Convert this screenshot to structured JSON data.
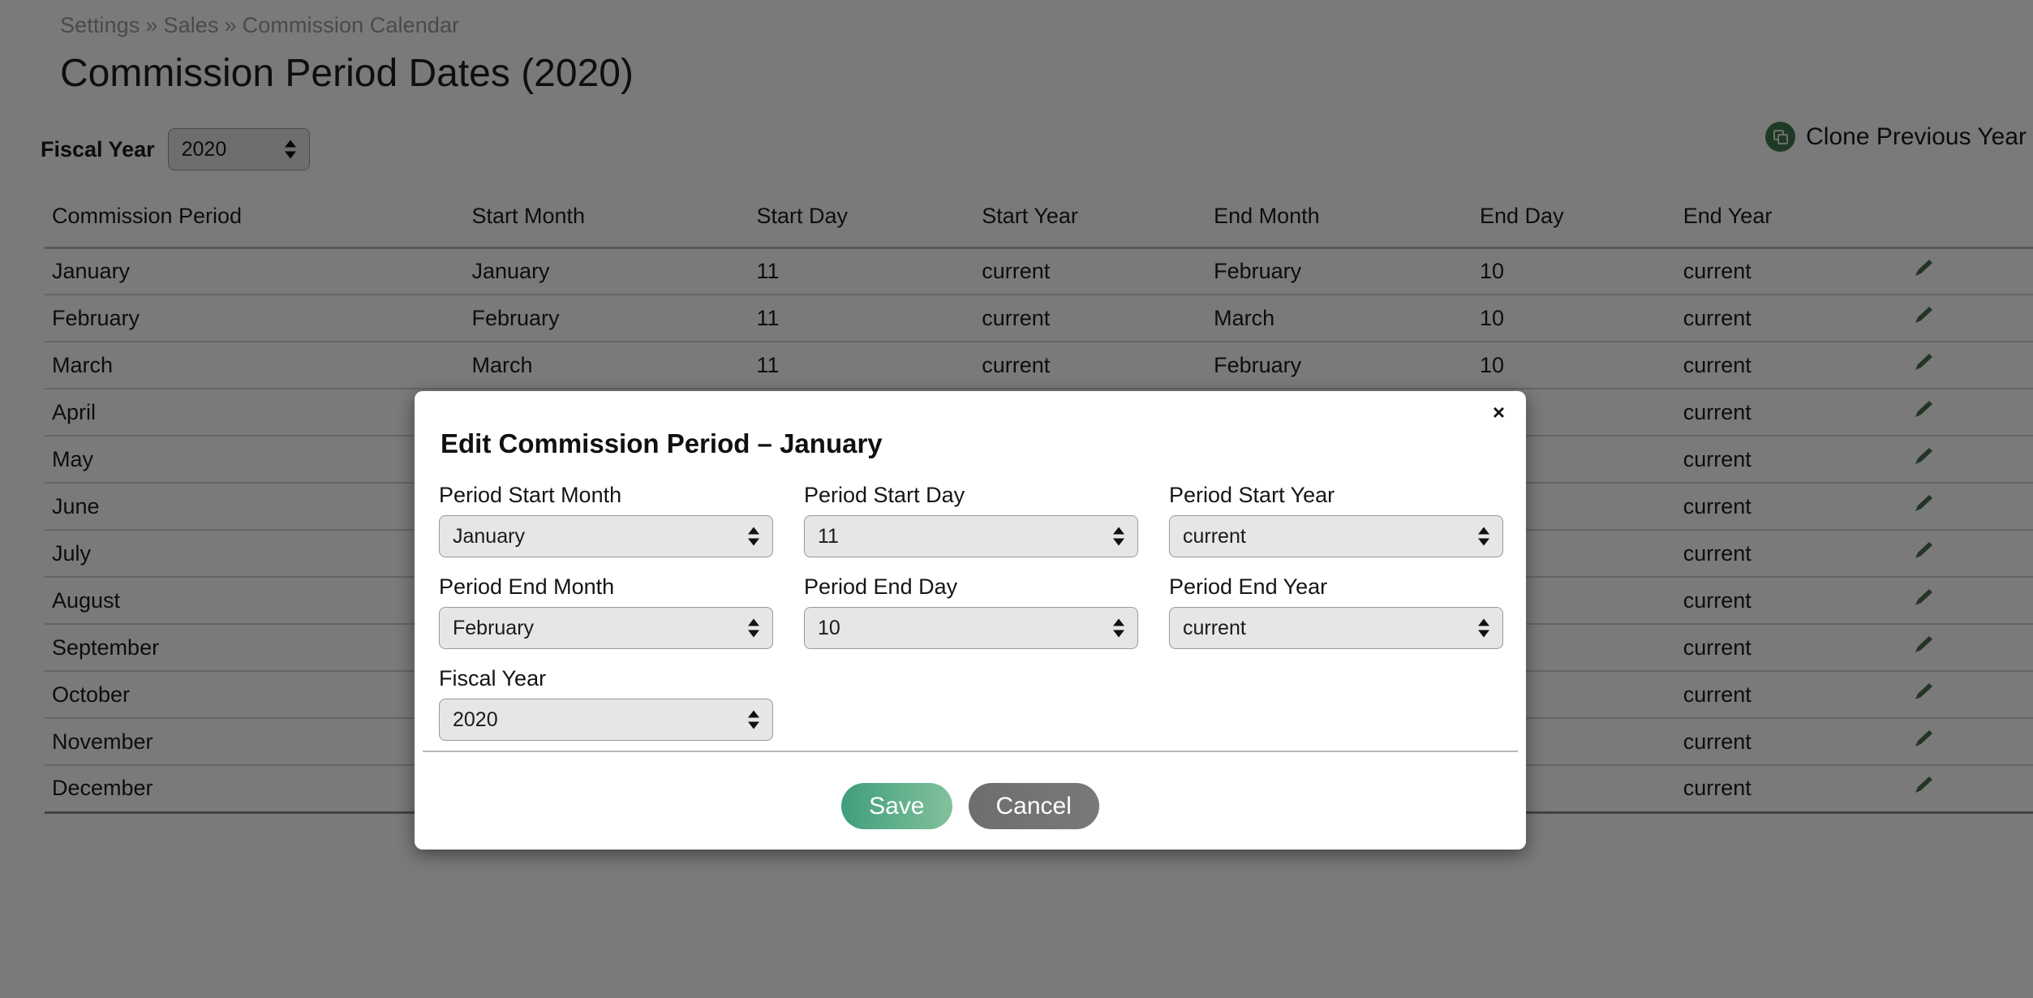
{
  "breadcrumb": {
    "items": [
      "Settings",
      "Sales",
      "Commission Calendar"
    ],
    "separator": "»"
  },
  "page_title": "Commission Period Dates (2020)",
  "fiscal_year_filter": {
    "label": "Fiscal Year",
    "value": "2020"
  },
  "clone_button": {
    "label": "Clone Previous Year",
    "icon": "copy-icon",
    "accent": "#3f7a4f"
  },
  "table": {
    "headers": [
      "Commission Period",
      "Start Month",
      "Start Day",
      "Start Year",
      "End Month",
      "End Day",
      "End Year",
      ""
    ],
    "edit_icon": "pencil-icon",
    "edit_icon_color": "#4a6f4f",
    "rows": [
      {
        "period": "January",
        "start_month": "January",
        "start_day": "11",
        "start_year": "current",
        "end_month": "February",
        "end_day": "10",
        "end_year": "current"
      },
      {
        "period": "February",
        "start_month": "February",
        "start_day": "11",
        "start_year": "current",
        "end_month": "March",
        "end_day": "10",
        "end_year": "current"
      },
      {
        "period": "March",
        "start_month": "March",
        "start_day": "11",
        "start_year": "current",
        "end_month": "February",
        "end_day": "10",
        "end_year": "current"
      },
      {
        "period": "April",
        "start_month": "",
        "start_day": "",
        "start_year": "",
        "end_month": "",
        "end_day": "",
        "end_year": "current"
      },
      {
        "period": "May",
        "start_month": "",
        "start_day": "",
        "start_year": "",
        "end_month": "",
        "end_day": "",
        "end_year": "current"
      },
      {
        "period": "June",
        "start_month": "",
        "start_day": "",
        "start_year": "",
        "end_month": "",
        "end_day": "",
        "end_year": "current"
      },
      {
        "period": "July",
        "start_month": "",
        "start_day": "",
        "start_year": "",
        "end_month": "",
        "end_day": "",
        "end_year": "current"
      },
      {
        "period": "August",
        "start_month": "",
        "start_day": "",
        "start_year": "",
        "end_month": "",
        "end_day": "",
        "end_year": "current"
      },
      {
        "period": "September",
        "start_month": "",
        "start_day": "",
        "start_year": "",
        "end_month": "",
        "end_day": "",
        "end_year": "current"
      },
      {
        "period": "October",
        "start_month": "",
        "start_day": "",
        "start_year": "",
        "end_month": "",
        "end_day": "",
        "end_year": "current"
      },
      {
        "period": "November",
        "start_month": "",
        "start_day": "",
        "start_year": "",
        "end_month": "",
        "end_day": "",
        "end_year": "current"
      },
      {
        "period": "December",
        "start_month": "",
        "start_day": "",
        "start_year": "",
        "end_month": "",
        "end_day": "",
        "end_year": "current"
      }
    ]
  },
  "modal": {
    "title": "Edit Commission Period – January",
    "close_label": "×",
    "fields": {
      "start_month": {
        "label": "Period Start Month",
        "value": "January"
      },
      "start_day": {
        "label": "Period Start Day",
        "value": "11"
      },
      "start_year": {
        "label": "Period Start Year",
        "value": "current"
      },
      "end_month": {
        "label": "Period End Month",
        "value": "February"
      },
      "end_day": {
        "label": "Period End Day",
        "value": "10"
      },
      "end_year": {
        "label": "Period End Year",
        "value": "current"
      },
      "fiscal_year": {
        "label": "Fiscal Year",
        "value": "2020"
      }
    },
    "save_label": "Save",
    "cancel_label": "Cancel",
    "save_color": "#3f9e7c",
    "cancel_color": "#6e6e6e"
  }
}
